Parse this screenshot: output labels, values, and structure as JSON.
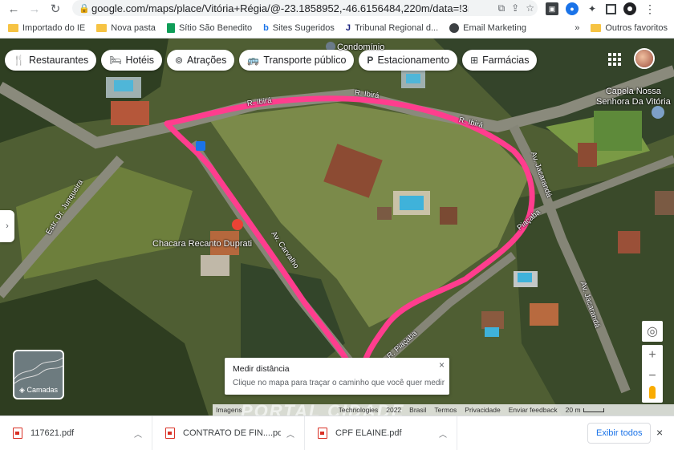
{
  "browser": {
    "url": "google.com/maps/place/Vitória+Régia/@-23.1858952,-46.6156484,220m/data=!3m1!1e3!4",
    "bookmarks": [
      "Importado do IE",
      "Nova pasta",
      "Sítio São Benedito",
      "Sites Sugeridos",
      "Tribunal Regional d...",
      "Email Marketing"
    ],
    "other_bookmarks": "Outros favoritos",
    "more": "»"
  },
  "map": {
    "chips": [
      {
        "label": "Restaurantes",
        "icon": "fork-knife-icon",
        "glyph": "🍴"
      },
      {
        "label": "Hotéis",
        "icon": "bed-icon",
        "glyph": "🛏"
      },
      {
        "label": "Atrações",
        "icon": "camera-icon",
        "glyph": "⊚"
      },
      {
        "label": "Transporte público",
        "icon": "bus-icon",
        "glyph": "🚌"
      },
      {
        "label": "Estacionamento",
        "icon": "parking-icon",
        "glyph": "P"
      },
      {
        "label": "Farmácias",
        "icon": "pharmacy-icon",
        "glyph": "⊞"
      }
    ],
    "places": {
      "condominio": "Condomínio",
      "capela_line1": "Capela Nossa",
      "capela_line2": "Senhora Da Vitória",
      "chacara": "Chacara Recanto Duprati"
    },
    "streets": {
      "ibira1": "R. Ibirá",
      "ibira2": "R. Ibirá",
      "ibira3": "R. Ibirá",
      "jacaranda1": "Av. Jacarandá",
      "jacaranda2": "Av. Jacarandá",
      "junqueira": "Estr. Dr. Junqueira",
      "carvalho": "Av. Carvalho",
      "piacaba": "R. Piaçaba",
      "piacaba_short": "Piaçaba"
    },
    "layers_label": "Camadas",
    "measure": {
      "title": "Medir distância",
      "hint": "Clique no mapa para traçar o caminho que você quer medir",
      "close": "×"
    },
    "footer": {
      "imagery": "Imagens",
      "technologies": "Technologies",
      "year": "2022",
      "country": "Brasil",
      "terms": "Termos",
      "privacy": "Privacidade",
      "feedback": "Enviar feedback",
      "scale": "20 m"
    },
    "watermark": "PORTAL CIDADE",
    "colors": {
      "route": "#ff3d8e",
      "accent": "#1a73e8"
    }
  },
  "downloads": {
    "files": [
      "117621.pdf",
      "CONTRATO DE FIN....pdf",
      "CPF ELAINE.pdf"
    ],
    "show_all": "Exibir todos",
    "close": "×"
  }
}
